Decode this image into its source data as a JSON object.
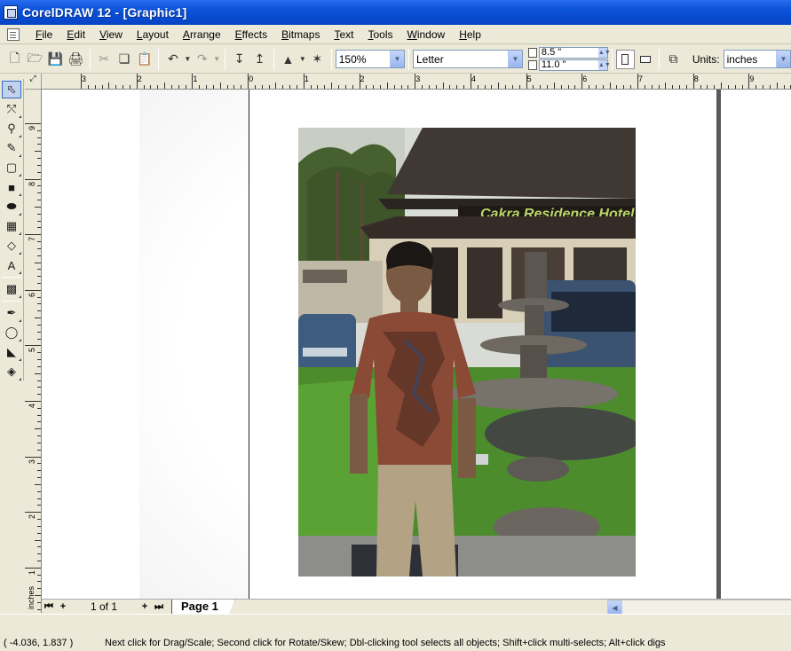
{
  "window": {
    "title": "CorelDRAW 12 - [Graphic1]"
  },
  "menu": [
    "File",
    "Edit",
    "View",
    "Layout",
    "Arrange",
    "Effects",
    "Bitmaps",
    "Text",
    "Tools",
    "Window",
    "Help"
  ],
  "toolbar": {
    "zoom_value": "150%",
    "paper_type": "Letter",
    "page_width": "8.5 \"",
    "page_height": "11.0 \"",
    "units_label": "Units:",
    "units_value": "inches"
  },
  "ruler": {
    "h_labels": [
      "3",
      "2",
      "1",
      "0",
      "1",
      "2",
      "3",
      "4",
      "5",
      "6",
      "7",
      "8",
      "9"
    ],
    "v_labels": [
      "9",
      "8",
      "7",
      "6",
      "5",
      "4",
      "3",
      "2",
      "1"
    ],
    "v_units": "inches"
  },
  "photo": {
    "sign_text": "Cakra Residence Hotel"
  },
  "pages": {
    "count_text": "1 of 1",
    "tabs": [
      "Page 1"
    ]
  },
  "status": {
    "coords": "( -4.036, 1.837 )",
    "hint": "Next click for Drag/Scale; Second click for Rotate/Skew; Dbl-clicking tool selects all objects; Shift+click multi-selects; Alt+click digs"
  }
}
